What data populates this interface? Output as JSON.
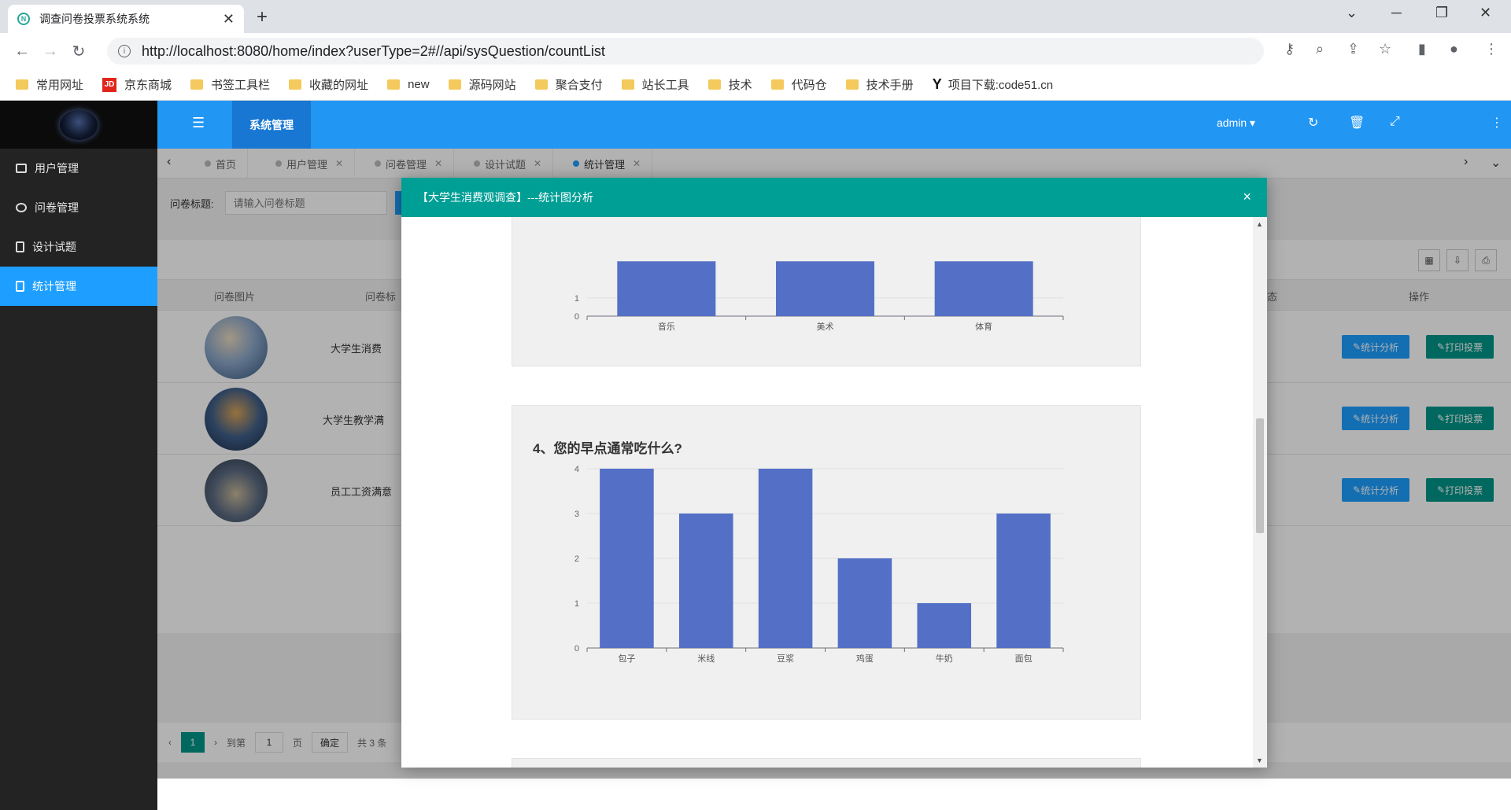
{
  "browser": {
    "tab_title": "调查问卷投票系统系统",
    "url": "http://localhost:8080/home/index?userType=2#//api/sysQuestion/countList",
    "bookmarks": [
      "常用网址",
      "京东商城",
      "书签工具栏",
      "收藏的网址",
      "new",
      "源码网站",
      "聚合支付",
      "站长工具",
      "技术",
      "代码仓",
      "技术手册",
      "项目下载:code51.cn"
    ]
  },
  "sidebar": {
    "items": [
      {
        "label": "用户管理",
        "active": false
      },
      {
        "label": "问卷管理",
        "active": false
      },
      {
        "label": "设计试题",
        "active": false
      },
      {
        "label": "统计管理",
        "active": true
      }
    ]
  },
  "topbar": {
    "section": "系统管理",
    "user": "admin"
  },
  "tabs": [
    {
      "label": "首页"
    },
    {
      "label": "用户管理"
    },
    {
      "label": "问卷管理"
    },
    {
      "label": "设计试题"
    },
    {
      "label": "统计管理"
    }
  ],
  "search": {
    "label": "问卷标题:",
    "placeholder": "请输入问卷标题"
  },
  "table": {
    "headers": {
      "image": "问卷图片",
      "title": "问卷标",
      "status": "态",
      "ops": "操作"
    },
    "rows": [
      {
        "title": "大学生消费"
      },
      {
        "title": "大学生教学满"
      },
      {
        "title": "员工工资满意"
      }
    ],
    "btn_stats": "统计分析",
    "btn_print": "打印投票"
  },
  "pager": {
    "current": "1",
    "goto": "到第",
    "page_input": "1",
    "page_unit": "页",
    "confirm": "确定",
    "total": "共 3 条"
  },
  "modal": {
    "title": "【大学生消费观调查】---统计图分析",
    "close": "×"
  },
  "chart_data": [
    {
      "type": "bar",
      "title": "",
      "categories": [
        "音乐",
        "美术",
        "体育"
      ],
      "values": [
        3,
        3,
        3
      ],
      "ylim": [
        0,
        4
      ],
      "visible_ticks": [
        0,
        1
      ],
      "color": "#5470c6",
      "note_partial": true
    },
    {
      "type": "bar",
      "title": "4、您的早点通常吃什么?",
      "categories": [
        "包子",
        "米线",
        "豆浆",
        "鸡蛋",
        "牛奶",
        "面包"
      ],
      "values": [
        4,
        3,
        4,
        2,
        1,
        3
      ],
      "ylim": [
        0,
        4
      ],
      "yticks": [
        0,
        1,
        2,
        3,
        4
      ],
      "color": "#5470c6"
    }
  ]
}
